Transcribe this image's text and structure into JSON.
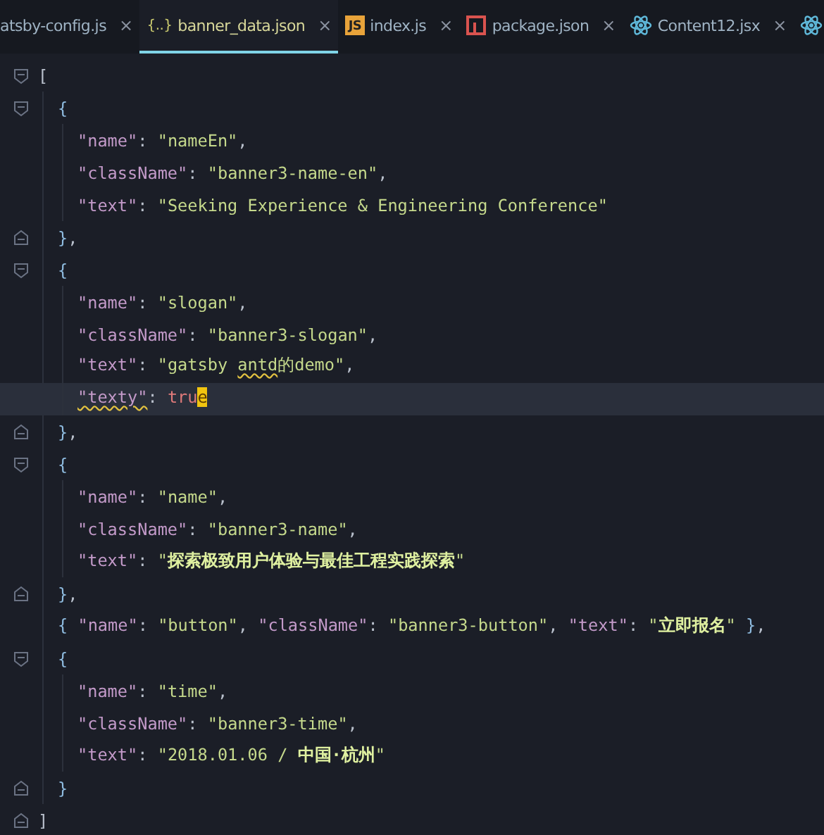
{
  "tabs": [
    {
      "kind": "plain",
      "label": "atsby-config.js",
      "close": "×",
      "selected": false
    },
    {
      "kind": "json",
      "icon_label": "{..}",
      "label": "banner_data.json",
      "close": "×",
      "selected": true
    },
    {
      "kind": "js",
      "icon_label": "JS",
      "label": "index.js",
      "close": "×",
      "selected": false
    },
    {
      "kind": "npm",
      "label": "package.json",
      "close": "×",
      "selected": false
    },
    {
      "kind": "react",
      "label": "Content12.jsx",
      "close": "×",
      "selected": false
    },
    {
      "kind": "react",
      "selected": false
    }
  ],
  "lines": [
    {
      "kind": "open",
      "current": false,
      "tokens": [
        {
          "kind": "punct",
          "text": "["
        }
      ],
      "children": [
        {
          "kind": "open",
          "current": false,
          "tokens": [
            {
              "kind": "brace",
              "text": "{"
            }
          ],
          "children": [
            {
              "current": false,
              "tokens": [
                {
                  "kind": "key",
                  "text": "\"name\""
                },
                {
                  "kind": "punct",
                  "text": ": "
                },
                {
                  "kind": "string",
                  "text": "\"nameEn\""
                },
                {
                  "kind": "punct",
                  "text": ","
                }
              ]
            },
            {
              "current": false,
              "tokens": [
                {
                  "kind": "key",
                  "text": "\"className\""
                },
                {
                  "kind": "punct",
                  "text": ": "
                },
                {
                  "kind": "string",
                  "text": "\"banner3-name-en\""
                },
                {
                  "kind": "punct",
                  "text": ","
                }
              ]
            },
            {
              "current": false,
              "tokens": [
                {
                  "kind": "key",
                  "text": "\"text\""
                },
                {
                  "kind": "punct",
                  "text": ": "
                },
                {
                  "kind": "string",
                  "text": "\"Seeking Experience & Engineering Conference\""
                }
              ]
            }
          ]
        },
        {
          "kind": "close",
          "current": false,
          "tokens": [
            {
              "kind": "brace",
              "text": "}"
            },
            {
              "kind": "punct",
              "text": ","
            }
          ]
        },
        {
          "kind": "open",
          "current": false,
          "tokens": [
            {
              "kind": "brace",
              "text": "{"
            }
          ],
          "children": [
            {
              "current": false,
              "tokens": [
                {
                  "kind": "key",
                  "text": "\"name\""
                },
                {
                  "kind": "punct",
                  "text": ": "
                },
                {
                  "kind": "string",
                  "text": "\"slogan\""
                },
                {
                  "kind": "punct",
                  "text": ","
                }
              ]
            },
            {
              "current": false,
              "tokens": [
                {
                  "kind": "key",
                  "text": "\"className\""
                },
                {
                  "kind": "punct",
                  "text": ": "
                },
                {
                  "kind": "string",
                  "text": "\"banner3-slogan\""
                },
                {
                  "kind": "punct",
                  "text": ","
                }
              ]
            },
            {
              "current": false,
              "tokens": [
                {
                  "kind": "key",
                  "text": "\"text\""
                },
                {
                  "kind": "punct",
                  "text": ": "
                },
                {
                  "kind": "string",
                  "text": "\"gatsby "
                },
                {
                  "kind": "string",
                  "text": "antd",
                  "warning": true
                },
                {
                  "kind": "string",
                  "text": "的demo\""
                },
                {
                  "kind": "punct",
                  "text": ","
                }
              ]
            },
            {
              "current": true,
              "tokens": [
                {
                  "kind": "key",
                  "text": "\"texty\"",
                  "warning": true
                },
                {
                  "kind": "punct",
                  "text": ": "
                },
                {
                  "kind": "keyword",
                  "text": "tru"
                },
                {
                  "kind": "cursor",
                  "text": "e"
                }
              ]
            }
          ]
        },
        {
          "kind": "close",
          "current": false,
          "tokens": [
            {
              "kind": "brace",
              "text": "}"
            },
            {
              "kind": "punct",
              "text": ","
            }
          ]
        },
        {
          "kind": "open",
          "current": false,
          "tokens": [
            {
              "kind": "brace",
              "text": "{"
            }
          ],
          "children": [
            {
              "current": false,
              "tokens": [
                {
                  "kind": "key",
                  "text": "\"name\""
                },
                {
                  "kind": "punct",
                  "text": ": "
                },
                {
                  "kind": "string",
                  "text": "\"name\""
                },
                {
                  "kind": "punct",
                  "text": ","
                }
              ]
            },
            {
              "current": false,
              "tokens": [
                {
                  "kind": "key",
                  "text": "\"className\""
                },
                {
                  "kind": "punct",
                  "text": ": "
                },
                {
                  "kind": "string",
                  "text": "\"banner3-name\""
                },
                {
                  "kind": "punct",
                  "text": ","
                }
              ]
            },
            {
              "current": false,
              "tokens": [
                {
                  "kind": "key",
                  "text": "\"text\""
                },
                {
                  "kind": "punct",
                  "text": ": "
                },
                {
                  "kind": "string",
                  "text": "\"**探索极致用户体验与最佳工程实践探索**\""
                }
              ]
            }
          ]
        },
        {
          "kind": "close",
          "current": false,
          "tokens": [
            {
              "kind": "brace",
              "text": "}"
            },
            {
              "kind": "punct",
              "text": ","
            }
          ]
        },
        {
          "current": false,
          "tokens": [
            {
              "kind": "brace",
              "text": "{ "
            },
            {
              "kind": "key",
              "text": "\"name\""
            },
            {
              "kind": "punct",
              "text": ": "
            },
            {
              "kind": "string",
              "text": "\"button\""
            },
            {
              "kind": "punct",
              "text": ", "
            },
            {
              "kind": "key",
              "text": "\"className\""
            },
            {
              "kind": "punct",
              "text": ": "
            },
            {
              "kind": "string",
              "text": "\"banner3-button\""
            },
            {
              "kind": "punct",
              "text": ", "
            },
            {
              "kind": "key",
              "text": "\"text\""
            },
            {
              "kind": "punct",
              "text": ": "
            },
            {
              "kind": "string",
              "text": "\"**立即报名**\""
            },
            {
              "kind": "brace",
              "text": " }"
            },
            {
              "kind": "punct",
              "text": ","
            }
          ]
        },
        {
          "kind": "open",
          "current": false,
          "tokens": [
            {
              "kind": "brace",
              "text": "{"
            }
          ],
          "children": [
            {
              "current": false,
              "tokens": [
                {
                  "kind": "key",
                  "text": "\"name\""
                },
                {
                  "kind": "punct",
                  "text": ": "
                },
                {
                  "kind": "string",
                  "text": "\"time\""
                },
                {
                  "kind": "punct",
                  "text": ","
                }
              ]
            },
            {
              "current": false,
              "tokens": [
                {
                  "kind": "key",
                  "text": "\"className\""
                },
                {
                  "kind": "punct",
                  "text": ": "
                },
                {
                  "kind": "string",
                  "text": "\"banner3-time\""
                },
                {
                  "kind": "punct",
                  "text": ","
                }
              ]
            },
            {
              "current": false,
              "tokens": [
                {
                  "kind": "key",
                  "text": "\"text\""
                },
                {
                  "kind": "punct",
                  "text": ": "
                },
                {
                  "kind": "string",
                  "text": "\"2018.01.06 / **中国·杭州**\""
                }
              ]
            }
          ]
        },
        {
          "kind": "close",
          "current": false,
          "tokens": [
            {
              "kind": "brace",
              "text": "}"
            }
          ]
        }
      ]
    },
    {
      "kind": "close",
      "current": false,
      "tokens": [
        {
          "kind": "punct",
          "text": "]"
        }
      ]
    }
  ]
}
